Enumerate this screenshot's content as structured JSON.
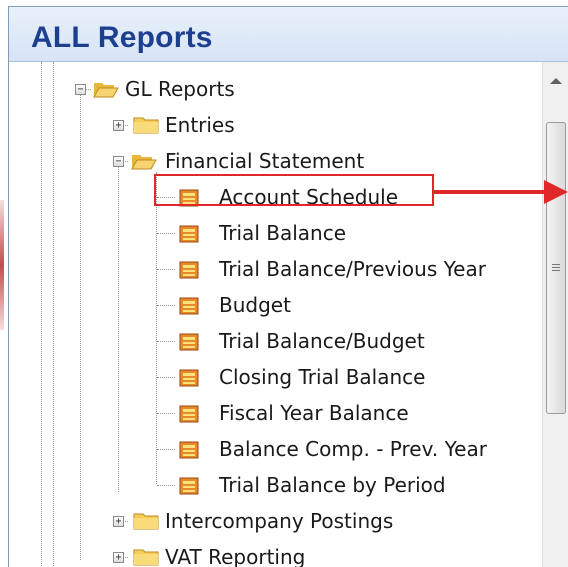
{
  "panel": {
    "title": "ALL Reports"
  },
  "tree": {
    "gl_reports": "GL Reports",
    "entries": "Entries",
    "financial_statement": "Financial Statement",
    "reports": [
      "Account Schedule",
      "Trial Balance",
      "Trial Balance/Previous Year",
      "Budget",
      "Trial Balance/Budget",
      "Closing Trial Balance",
      "Fiscal Year Balance",
      "Balance Comp. - Prev. Year",
      "Trial Balance by Period"
    ],
    "intercompany_postings": "Intercompany Postings",
    "vat_reporting": "VAT Reporting"
  },
  "selected_item": "Account Schedule",
  "colors": {
    "title": "#1c3f8f",
    "highlight": "#e2262a",
    "folder": "#f5c94c"
  }
}
